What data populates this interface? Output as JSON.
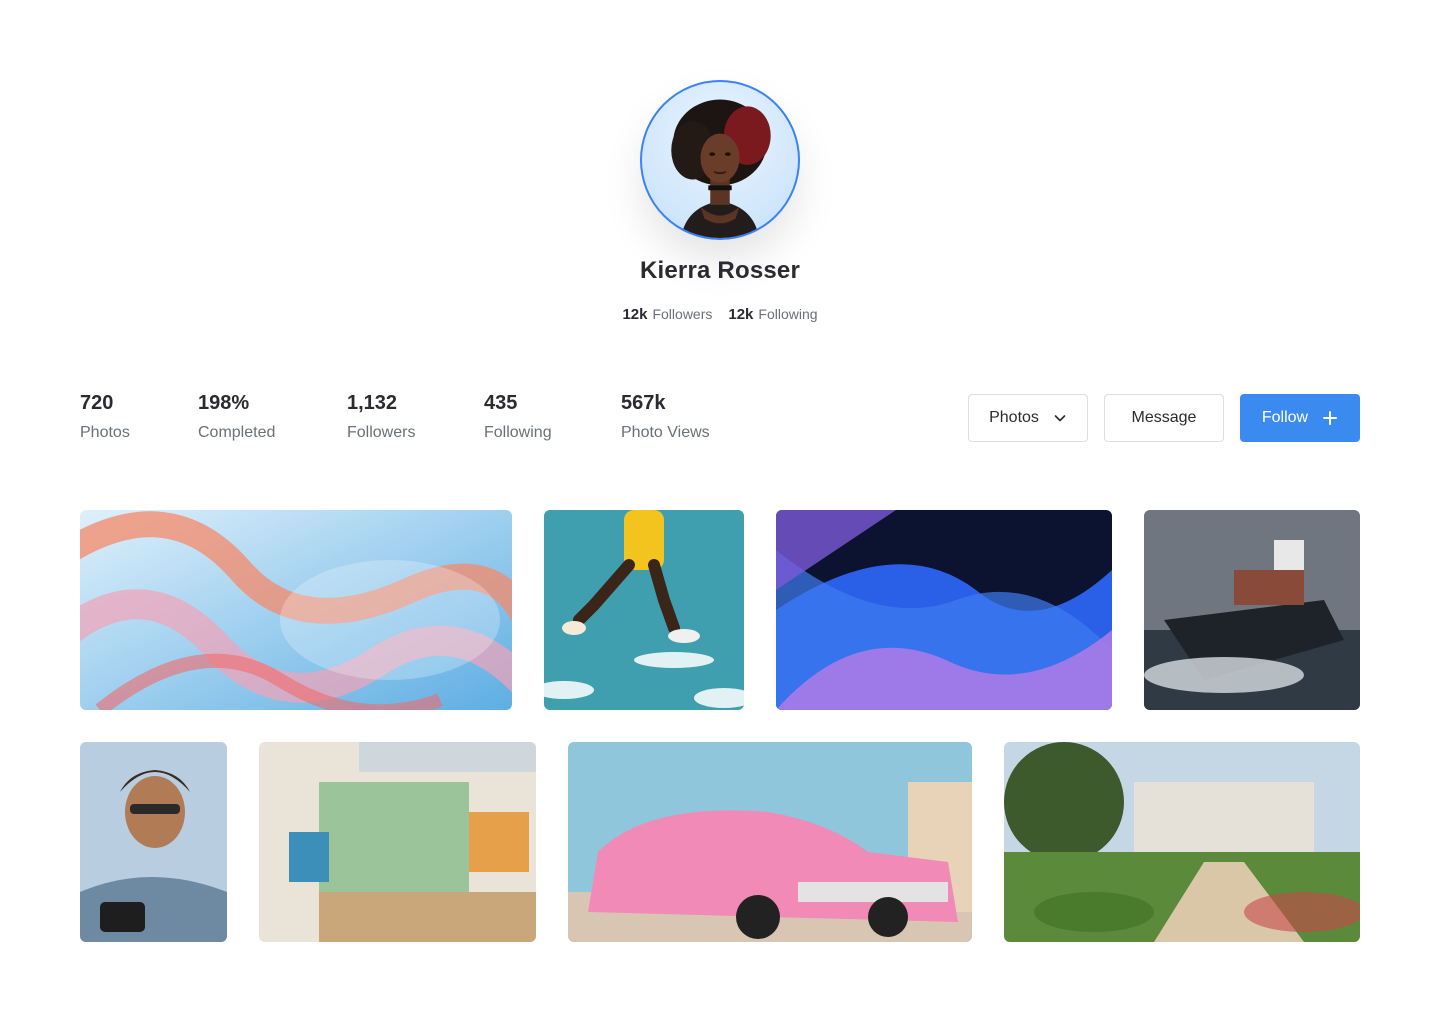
{
  "profile": {
    "name": "Kierra Rosser",
    "followers_count": "12k",
    "followers_label": "Followers",
    "following_count": "12k",
    "following_label": "Following"
  },
  "stats": [
    {
      "value": "720",
      "label": "Photos"
    },
    {
      "value": "198%",
      "label": "Completed"
    },
    {
      "value": "1,132",
      "label": "Followers"
    },
    {
      "value": "435",
      "label": "Following"
    },
    {
      "value": "567k",
      "label": "Photo Views"
    }
  ],
  "actions": {
    "filter_selected": "Photos",
    "message_label": "Message",
    "follow_label": "Follow"
  },
  "colors": {
    "accent": "#3b8af0",
    "avatar_ring": "#3b82f6"
  },
  "gallery": [
    {
      "subject": "abstract glass waves"
    },
    {
      "subject": "jumping athlete"
    },
    {
      "subject": "blue purple abstract"
    },
    {
      "subject": "cargo ship"
    },
    {
      "subject": "smiling photographer"
    },
    {
      "subject": "art studio"
    },
    {
      "subject": "pink classic car"
    },
    {
      "subject": "palace garden"
    }
  ]
}
